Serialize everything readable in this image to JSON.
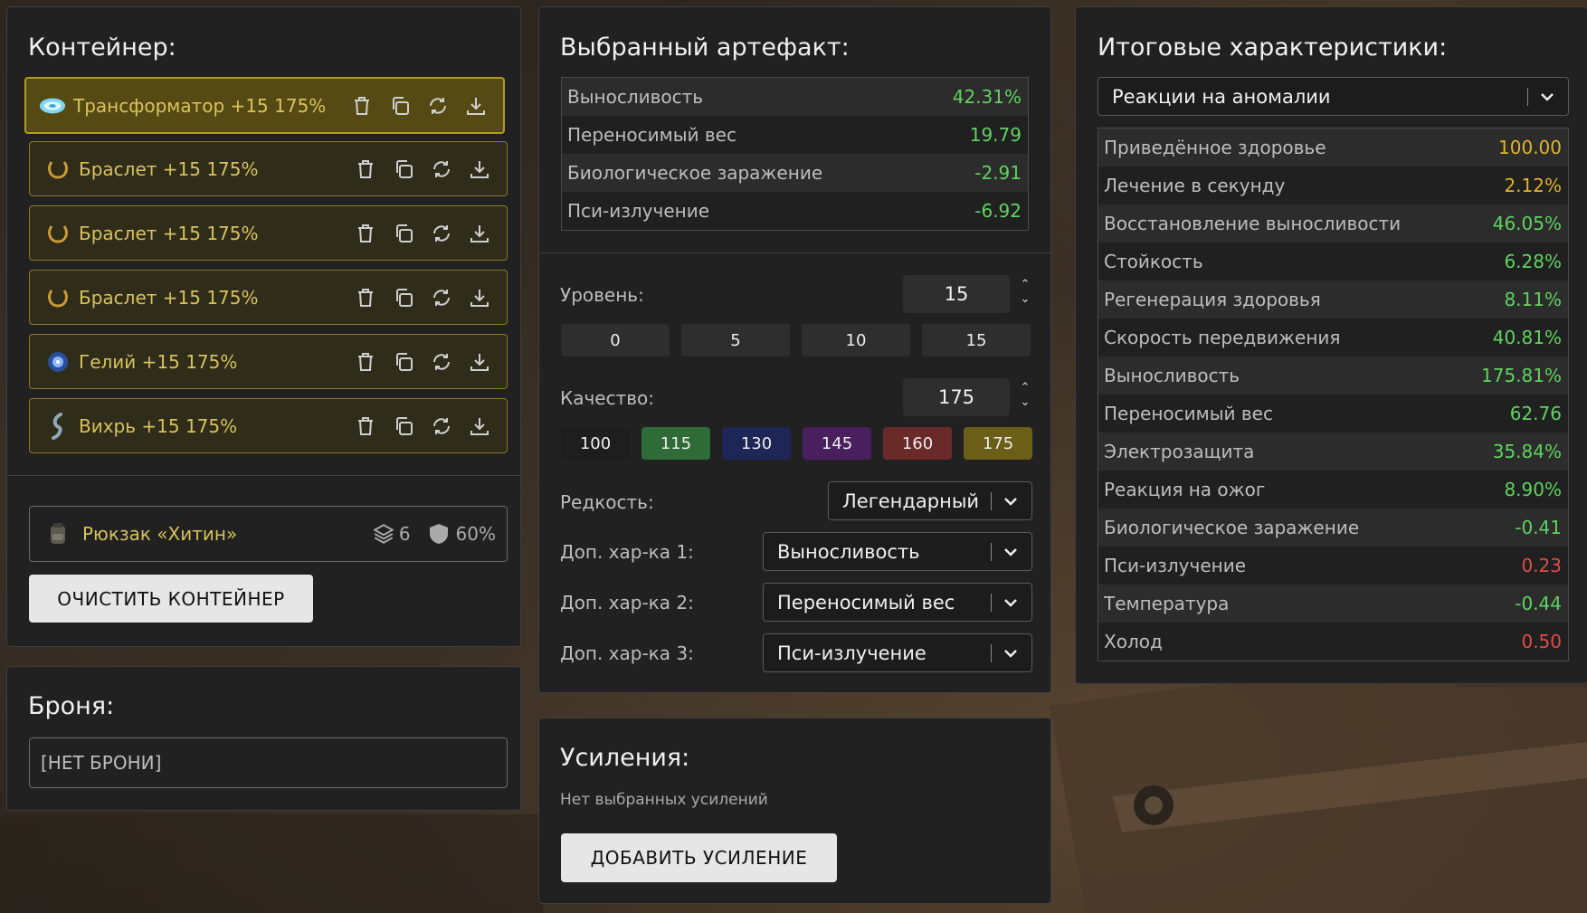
{
  "container": {
    "title": "Контейнер:",
    "items": [
      {
        "name": "Трансформатор +15 175%",
        "icon": "transformer-artifact-icon",
        "selected": true
      },
      {
        "name": "Браслет +15 175%",
        "icon": "bracelet-artifact-icon"
      },
      {
        "name": "Браслет +15 175%",
        "icon": "bracelet-artifact-icon"
      },
      {
        "name": "Браслет +15 175%",
        "icon": "bracelet-artifact-icon"
      },
      {
        "name": "Гелий +15 175%",
        "icon": "helium-artifact-icon"
      },
      {
        "name": "Вихрь +15 175%",
        "icon": "whirl-artifact-icon"
      }
    ],
    "backpack": {
      "name": "Рюкзак «Хитин»",
      "slots": "6",
      "protection": "60%"
    },
    "clear_button": "ОЧИСТИТЬ КОНТЕЙНЕР"
  },
  "armor": {
    "title": "Броня:",
    "value": "[НЕТ БРОНИ]"
  },
  "artifact": {
    "title": "Выбранный артефакт:",
    "stats": [
      {
        "name": "Выносливость",
        "value": "42.31%",
        "color": "green"
      },
      {
        "name": "Переносимый вес",
        "value": "19.79",
        "color": "green"
      },
      {
        "name": "Биологическое заражение",
        "value": "-2.91",
        "color": "green"
      },
      {
        "name": "Пси-излучение",
        "value": "-6.92",
        "color": "green"
      }
    ],
    "level_label": "Уровень:",
    "level_value": "15",
    "level_presets": [
      "0",
      "5",
      "10",
      "15"
    ],
    "quality_label": "Качество:",
    "quality_value": "175",
    "quality_presets": [
      {
        "label": "100",
        "color": "#1e1e1e"
      },
      {
        "label": "115",
        "color": "#2f6b37"
      },
      {
        "label": "130",
        "color": "#1e2557"
      },
      {
        "label": "145",
        "color": "#4a1f5e"
      },
      {
        "label": "160",
        "color": "#6b2a2a"
      },
      {
        "label": "175",
        "color": "#6b5e17"
      }
    ],
    "rarity_label": "Редкость:",
    "rarity_value": "Легендарный",
    "extra1_label": "Доп. хар-ка 1:",
    "extra1_value": "Выносливость",
    "extra2_label": "Доп. хар-ка 2:",
    "extra2_value": "Переносимый вес",
    "extra3_label": "Доп. хар-ка 3:",
    "extra3_value": "Пси-излучение"
  },
  "boosts": {
    "title": "Усиления:",
    "empty_text": "Нет выбранных усилений",
    "add_button": "ДОБАВИТЬ УСИЛЕНИЕ"
  },
  "totals": {
    "title": "Итоговые характеристики:",
    "filter_value": "Реакции на аномалии",
    "stats": [
      {
        "name": "Приведённое здоровье",
        "value": "100.00",
        "color": "yellow"
      },
      {
        "name": "Лечение в секунду",
        "value": "2.12%",
        "color": "yellow"
      },
      {
        "name": "Восстановление выносливости",
        "value": "46.05%",
        "color": "green"
      },
      {
        "name": "Стойкость",
        "value": "6.28%",
        "color": "green"
      },
      {
        "name": "Регенерация здоровья",
        "value": "8.11%",
        "color": "green"
      },
      {
        "name": "Скорость передвижения",
        "value": "40.81%",
        "color": "green"
      },
      {
        "name": "Выносливость",
        "value": "175.81%",
        "color": "green"
      },
      {
        "name": "Переносимый вес",
        "value": "62.76",
        "color": "green"
      },
      {
        "name": "Электрозащита",
        "value": "35.84%",
        "color": "green"
      },
      {
        "name": "Реакция на ожог",
        "value": "8.90%",
        "color": "green"
      },
      {
        "name": "Биологическое заражение",
        "value": "-0.41",
        "color": "green"
      },
      {
        "name": "Пси-излучение",
        "value": "0.23",
        "color": "red"
      },
      {
        "name": "Температура",
        "value": "-0.44",
        "color": "green"
      },
      {
        "name": "Холод",
        "value": "0.50",
        "color": "red"
      }
    ]
  }
}
